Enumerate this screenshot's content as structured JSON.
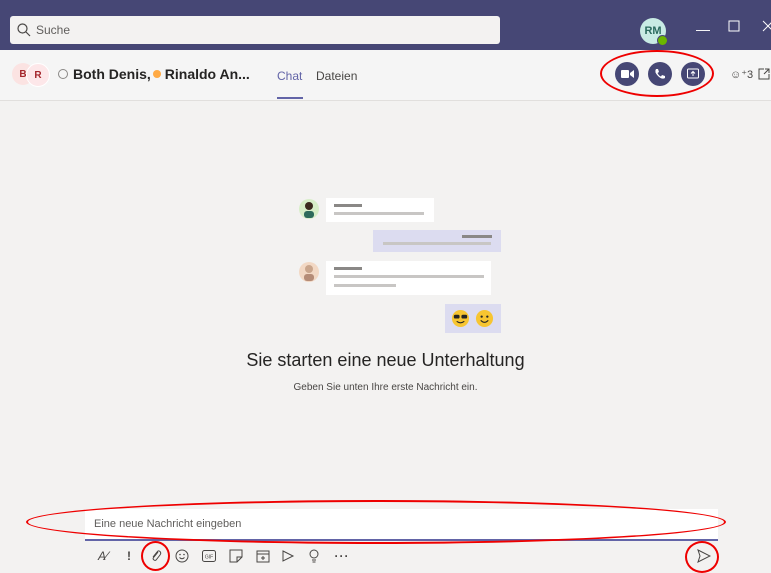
{
  "search": {
    "placeholder": "Suche"
  },
  "profile": {
    "initials": "RM"
  },
  "chat": {
    "title_part1": "Both Denis,",
    "title_part2": "Rinaldo An...",
    "avatar_initials_1": "B",
    "avatar_initials_2": "R"
  },
  "tabs": [
    {
      "label": "Chat"
    },
    {
      "label": "Dateien"
    }
  ],
  "participants": {
    "count": "3"
  },
  "empty_state": {
    "headline": "Sie starten eine neue Unterhaltung",
    "subline": "Geben Sie unten Ihre erste Nachricht ein."
  },
  "compose": {
    "placeholder": "Eine neue Nachricht eingeben"
  },
  "colors": {
    "titlebar": "#464775",
    "accent": "#6264a7",
    "annotation": "#e00000"
  }
}
